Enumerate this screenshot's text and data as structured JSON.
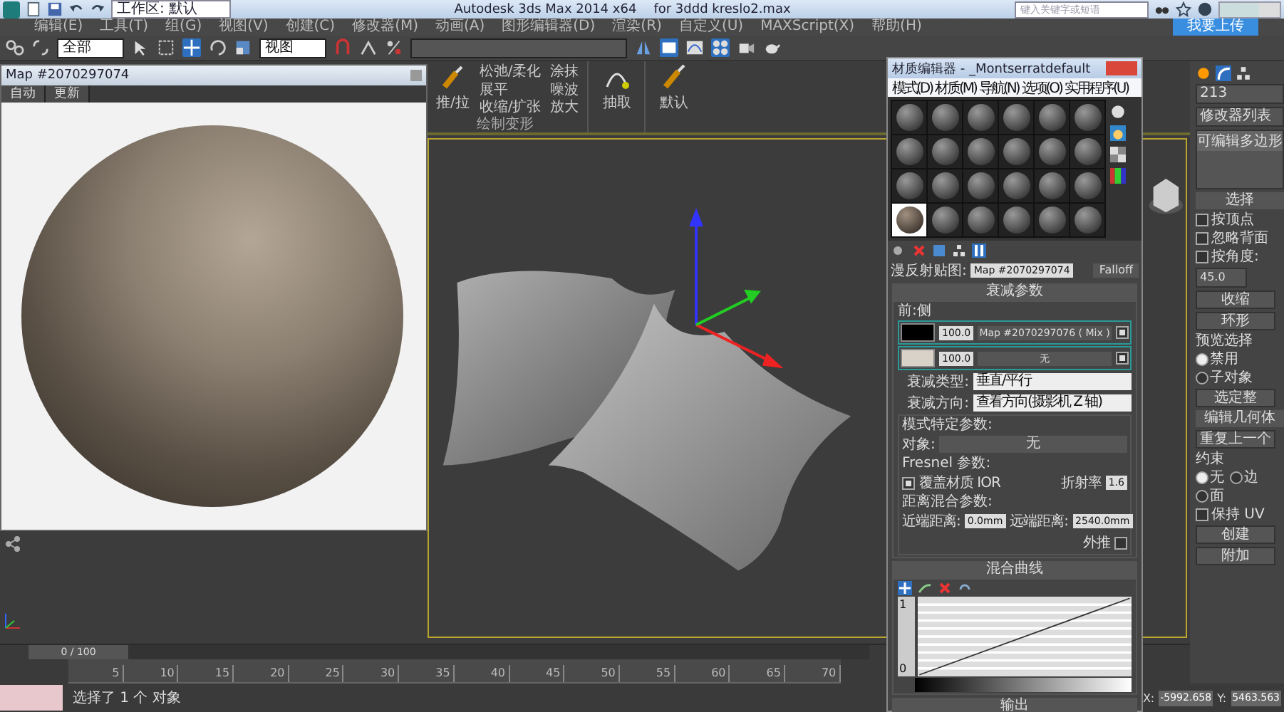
{
  "title_bar": {
    "workspace": "工作区: 默认",
    "app_title": "Autodesk 3ds Max  2014 x64",
    "file_name": "for 3ddd kreslo2.max",
    "search": {
      "placeholder": "键入关键字或短语"
    }
  },
  "menu": [
    "编辑(E)",
    "工具(T)",
    "组(G)",
    "视图(V)",
    "创建(C)",
    "修改器(M)",
    "动画(A)",
    "图形编辑器(D)",
    "渲染(R)",
    "自定义(U)",
    "MAXScript(X)",
    "帮助(H)"
  ],
  "upload_button": "我要上传",
  "toolbar": {
    "selection_filter": "全部",
    "reference_coord": "视图"
  },
  "ribbon": {
    "main_tool": "推/拉",
    "tools": [
      "松弛/柔化",
      "涂抹",
      "展平",
      "噪波",
      "收缩/扩张",
      "放大"
    ],
    "group_label": "绘制变形",
    "extract": "抽取",
    "default": "默认"
  },
  "map_window": {
    "title": "Map #2070297074",
    "buttons": [
      "自动",
      "更新"
    ]
  },
  "material_editor": {
    "title": "材质编辑器 - _Montserratdefault",
    "menu": [
      "模式(D)",
      "材质(M)",
      "导航(N)",
      "选项(O)",
      "实用程序(U)"
    ],
    "slots": [
      {
        "selected": false
      },
      {
        "selected": false
      },
      {
        "selected": false
      },
      {
        "selected": false
      },
      {
        "selected": false
      },
      {
        "selected": false
      },
      {
        "selected": false
      },
      {
        "selected": false
      },
      {
        "selected": false
      },
      {
        "selected": false
      },
      {
        "selected": false
      },
      {
        "selected": false
      },
      {
        "selected": false
      },
      {
        "selected": false
      },
      {
        "selected": false
      },
      {
        "selected": false
      },
      {
        "selected": false
      },
      {
        "selected": false
      },
      {
        "selected": true
      },
      {
        "selected": false
      },
      {
        "selected": false
      },
      {
        "selected": false
      },
      {
        "selected": false
      },
      {
        "selected": false
      }
    ],
    "map_label": "漫反射贴图:",
    "map_name": "Map #2070297074",
    "map_type": "Falloff",
    "falloff": {
      "title": "衰减参数",
      "group": "前:侧",
      "rows": [
        {
          "color": "#000000",
          "amount": "100.0",
          "map": "Map #2070297076 ( Mix )",
          "checked": true
        },
        {
          "color": "#d8d2c8",
          "amount": "100.0",
          "map": "无",
          "checked": true
        }
      ],
      "type_label": "衰减类型:",
      "type_value": "垂直/平行",
      "direction_label": "衰减方向:",
      "direction_value": "查看方向(摄影机 Z 轴)"
    },
    "mode_params": {
      "title": "模式特定参数:",
      "object_label": "对象:",
      "object_value": "无",
      "fresnel": "Fresnel 参数:",
      "override": {
        "label": "覆盖材质 IOR",
        "checked": true
      },
      "ior_label": "折射率",
      "ior_value": "1.6",
      "distance": "距离混合参数:",
      "near_label": "近端距离:",
      "near_value": "0.0mm",
      "far_label": "远端距离:",
      "far_value": "2540.0mm",
      "extrapolate": {
        "label": "外推",
        "checked": false
      }
    },
    "mix_curve": {
      "title": "混合曲线",
      "top_label": "1",
      "bottom_label": "0"
    },
    "output": "输出"
  },
  "command_panel": {
    "object_name": "213",
    "modifier_list": "修改器列表",
    "stack": [
      "可编辑多边形"
    ],
    "selection_title": "选择",
    "checks": [
      {
        "label": "按顶点",
        "checked": false
      },
      {
        "label": "忽略背面",
        "checked": false
      },
      {
        "label": "按角度:",
        "checked": false
      }
    ],
    "angle": "45.0",
    "buttons": [
      "收缩",
      "环形"
    ],
    "preview_label": "预览选择",
    "preview_options": [
      {
        "label": "禁用",
        "selected": true
      },
      {
        "label": "子对象",
        "selected": false
      }
    ],
    "select_whole": "选定整",
    "geometry_title": "编辑几何体",
    "repeat": "重复上一个",
    "constraint_label": "约束",
    "constraints": [
      {
        "label": "无",
        "selected": true
      },
      {
        "label": "边",
        "selected": false
      },
      {
        "label": "面",
        "selected": false
      }
    ],
    "preserve_uv": {
      "label": "保持 UV",
      "checked": false
    },
    "create": "创建",
    "attach": "附加"
  },
  "timeline": {
    "frame": "0 / 100",
    "level": 0,
    "ticks": [
      "5",
      "10",
      "15",
      "20",
      "25",
      "30",
      "35",
      "40",
      "45",
      "50",
      "55",
      "60",
      "65",
      "70"
    ]
  },
  "status_bar": {
    "message": "选择了 1 个 对象",
    "x_label": "X:",
    "x_value": "-5992.658",
    "y_label": "Y:",
    "y_value": "5463.563"
  }
}
